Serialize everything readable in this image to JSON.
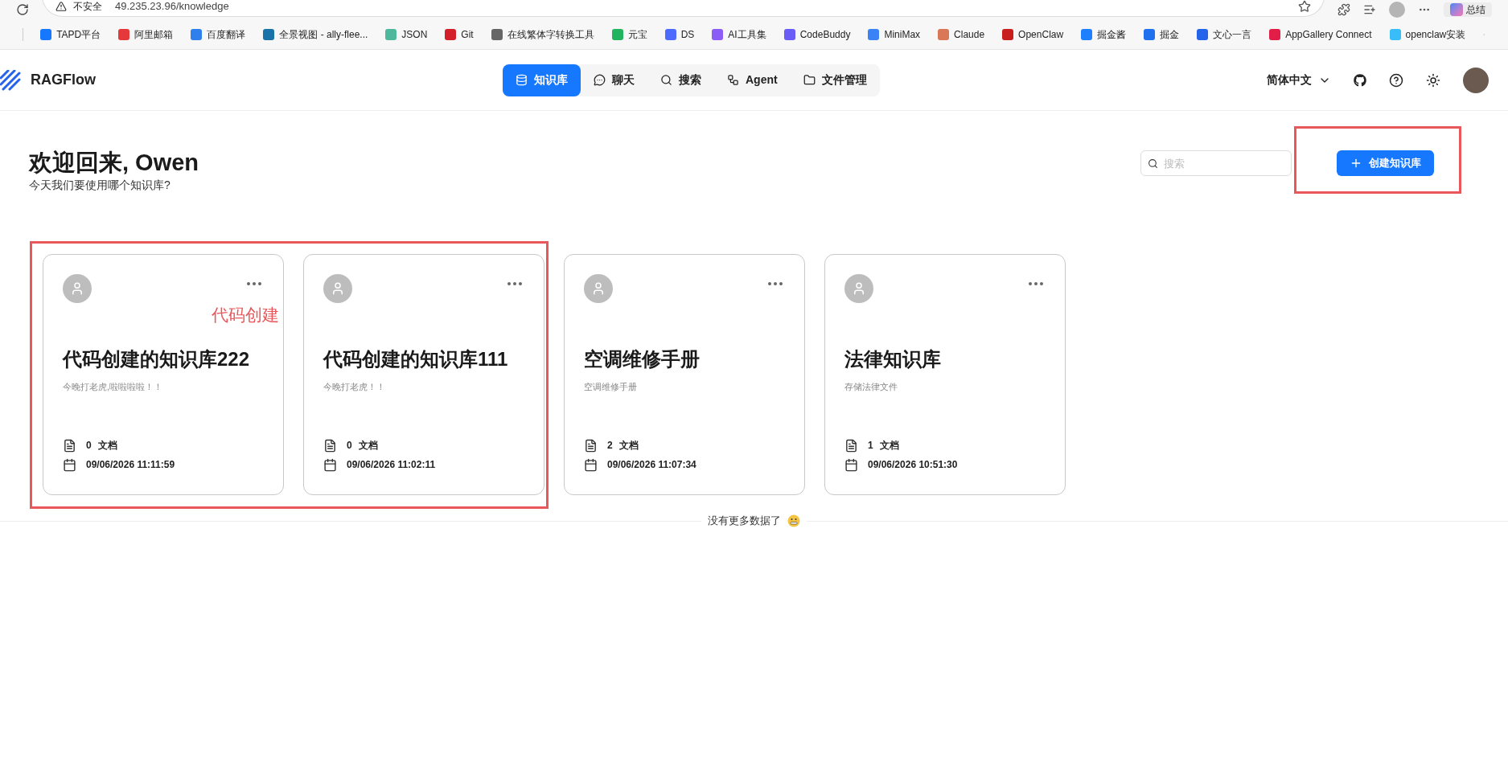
{
  "browser": {
    "security_label": "不安全",
    "url": "49.235.23.96/knowledge",
    "summary_button": "总结",
    "bookmarks": [
      {
        "label": "TAPD平台",
        "color": "#1677ff"
      },
      {
        "label": "阿里邮箱",
        "color": "#e5383b"
      },
      {
        "label": "百度翻译",
        "color": "#2f80ed"
      },
      {
        "label": "全景视图 - ally-flee...",
        "color": "#1a73a8"
      },
      {
        "label": "JSON",
        "color": "#4fb89c"
      },
      {
        "label": "Git",
        "color": "#d21f2a"
      },
      {
        "label": "在线繁体字转换工具",
        "color": "#666666"
      },
      {
        "label": "元宝",
        "color": "#22b35e"
      },
      {
        "label": "DS",
        "color": "#4d6bfe"
      },
      {
        "label": "AI工具集",
        "color": "#8b5cf6"
      },
      {
        "label": "CodeBuddy",
        "color": "#6a5cf6"
      },
      {
        "label": "MiniMax",
        "color": "#3b82f6"
      },
      {
        "label": "Claude",
        "color": "#d97757"
      },
      {
        "label": "OpenClaw",
        "color": "#c81e1e"
      },
      {
        "label": "掘金酱",
        "color": "#1e80ff"
      },
      {
        "label": "掘金",
        "color": "#1e70ef"
      },
      {
        "label": "文心一言",
        "color": "#2563eb"
      },
      {
        "label": "AppGallery Connect",
        "color": "#e11d48"
      },
      {
        "label": "openclaw安装",
        "color": "#38bdf8"
      }
    ]
  },
  "app": {
    "brand": "RAGFlow",
    "nav": [
      {
        "label": "知识库",
        "selected": true
      },
      {
        "label": "聊天",
        "selected": false
      },
      {
        "label": "搜索",
        "selected": false
      },
      {
        "label": "Agent",
        "selected": false
      },
      {
        "label": "文件管理",
        "selected": false
      }
    ],
    "language": "简体中文"
  },
  "welcome": {
    "title": "欢迎回来, Owen",
    "subtitle": "今天我们要使用哪个知识库?"
  },
  "search": {
    "placeholder": "搜索"
  },
  "create_button": "创建知识库",
  "cards": [
    {
      "title": "代码创建的知识库222",
      "description": "今晚打老虎,啦啦啦啦！！",
      "doc_count": "0",
      "doc_unit": "文档",
      "created": "09/06/2026 11:11:59"
    },
    {
      "title": "代码创建的知识库111",
      "description": "今晚打老虎！！",
      "doc_count": "0",
      "doc_unit": "文档",
      "created": "09/06/2026 11:02:11"
    },
    {
      "title": "空调维修手册",
      "description": "空调维修手册",
      "doc_count": "2",
      "doc_unit": "文档",
      "created": "09/06/2026 11:07:34"
    },
    {
      "title": "法律知识库",
      "description": "存储法律文件",
      "doc_count": "1",
      "doc_unit": "文档",
      "created": "09/06/2026 10:51:30"
    }
  ],
  "footer": "没有更多数据了",
  "annotation": {
    "note": "代码创建"
  }
}
